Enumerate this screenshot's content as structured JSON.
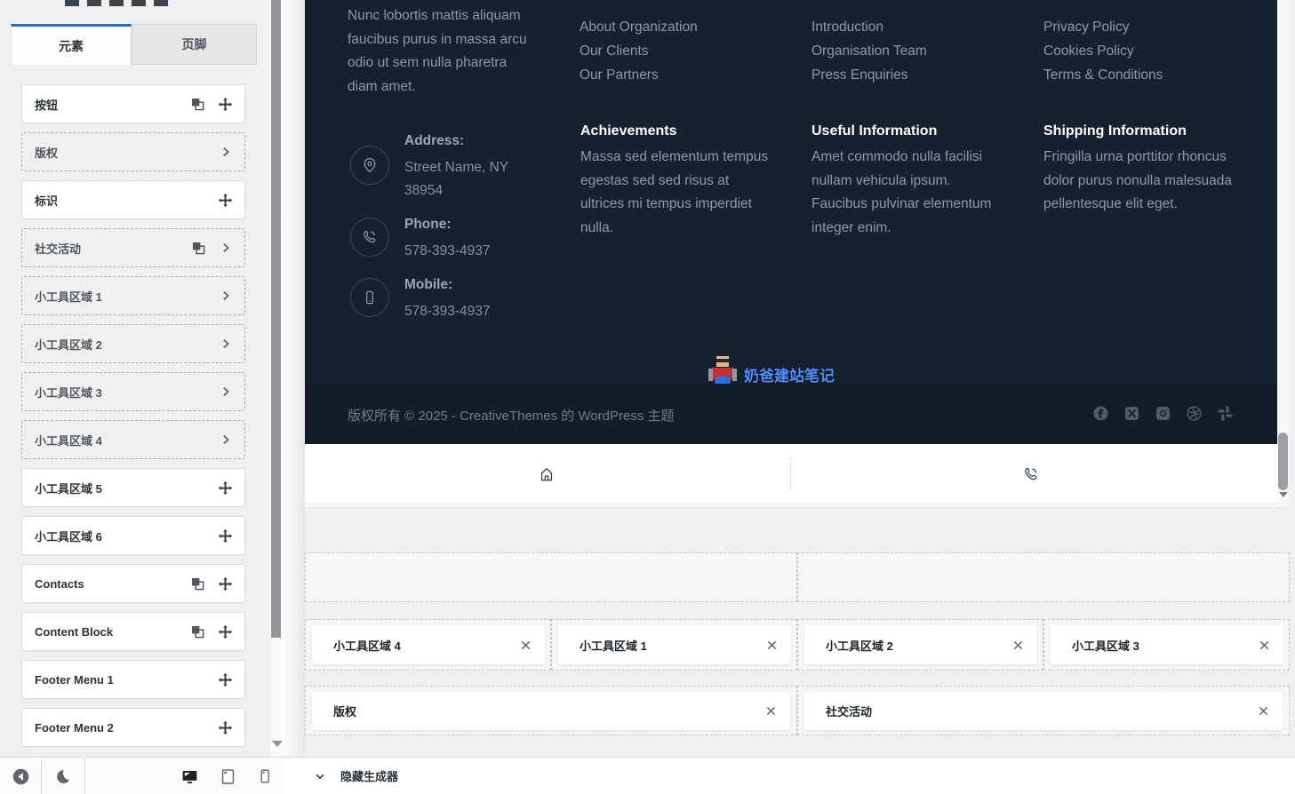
{
  "sidebar": {
    "tabs": [
      {
        "label": "元素"
      },
      {
        "label": "页脚"
      }
    ],
    "items": [
      {
        "label": "按钮"
      },
      {
        "label": "版权"
      },
      {
        "label": "标识"
      },
      {
        "label": "社交活动"
      },
      {
        "label": "小工具区域 1"
      },
      {
        "label": "小工具区域 2"
      },
      {
        "label": "小工具区域 3"
      },
      {
        "label": "小工具区域 4"
      },
      {
        "label": "小工具区域 5"
      },
      {
        "label": "小工具区域 6"
      },
      {
        "label": "Contacts"
      },
      {
        "label": "Content Block"
      },
      {
        "label": "Footer Menu 1"
      },
      {
        "label": "Footer Menu 2"
      }
    ]
  },
  "preview": {
    "about_text": "Nunc lobortis mattis aliquam faucibus purus in massa arcu odio ut sem nulla pharetra diam amet.",
    "menus": {
      "col2": [
        "About Organization",
        "Our Clients",
        "Our Partners"
      ],
      "col3": [
        "Introduction",
        "Organisation Team",
        "Press Enquiries"
      ],
      "col4": [
        "Privacy Policy",
        "Cookies Policy",
        "Terms & Conditions"
      ]
    },
    "sections": [
      {
        "heading": "Achievements",
        "text": "Massa sed elementum tempus egestas sed sed risus at ultrices mi tempus imperdiet nulla."
      },
      {
        "heading": "Useful Information",
        "text": "Amet commodo nulla facilisi nullam vehicula ipsum. Faucibus pulvinar elementum integer enim."
      },
      {
        "heading": "Shipping Information",
        "text": "Fringilla urna porttitor rhoncus dolor purus nonulla malesuada pellentesque elit eget."
      }
    ],
    "contacts": [
      {
        "label": "Address:",
        "value": "Street Name, NY 38954"
      },
      {
        "label": "Phone:",
        "value": "578-393-4937"
      },
      {
        "label": "Mobile:",
        "value": "578-393-4937"
      }
    ],
    "social_icons": [
      "facebook-icon",
      "x-icon",
      "instagram-icon",
      "dribbble-icon",
      "slack-icon"
    ],
    "strip_icons": [
      "home-icon",
      "phone-icon"
    ],
    "watermark_text": "奶爸建站笔记",
    "copyright": "版权所有 © 2025 - CreativeThemes 的 WordPress 主题"
  },
  "builder": {
    "row2_chips": [
      "小工具区域 4",
      "小工具区域 1",
      "小工具区域 2",
      "小工具区域 3"
    ],
    "row3_chips": [
      "版权",
      "社交活动"
    ],
    "hide_label": "隐藏生成器"
  },
  "bottombar_icons": [
    "back-icon",
    "moon-icon",
    "desktop-icon",
    "tablet-icon",
    "mobile-device-icon"
  ],
  "colors": {
    "accent_blue": "#2271b1",
    "footer_bg": "#16212e",
    "footer_bottom_bg": "#131d28",
    "footer_text": "#8d99a9",
    "page_bg": "#f0f0f1",
    "watermark_blue": "#4f8dfb"
  }
}
